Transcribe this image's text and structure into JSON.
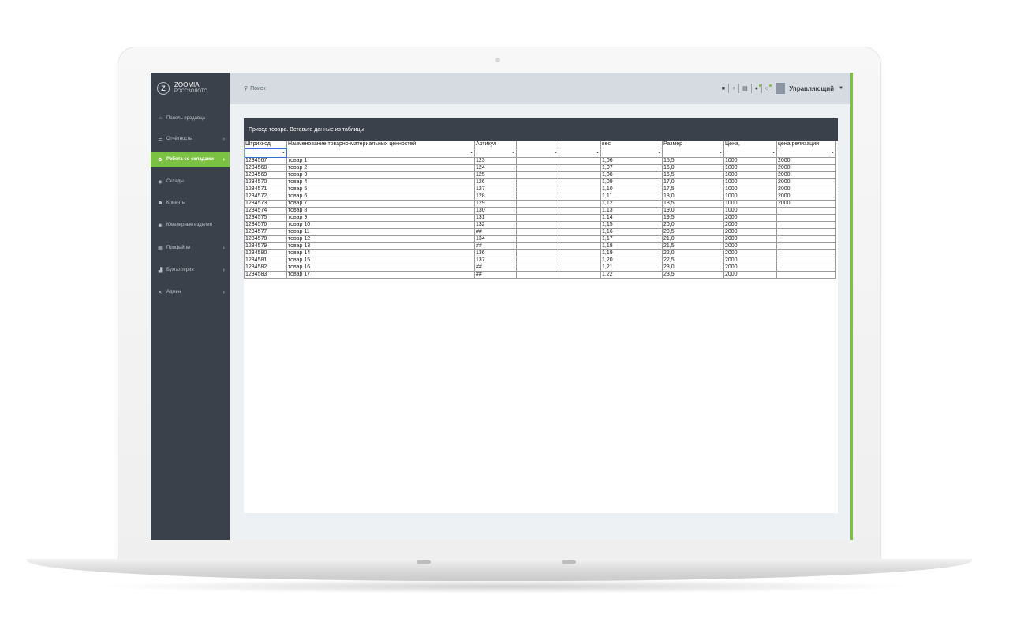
{
  "app": {
    "brand_name": "ZOOMIA",
    "brand_sub": "РОССЗОЛОТО",
    "logo_letter": "Z"
  },
  "colors": {
    "accent": "#7cc242",
    "sidebar": "#3a414a",
    "topbar": "#d5dbe1"
  },
  "sidebar": {
    "items": [
      {
        "label": "Панель продавца",
        "icon": "home-icon",
        "glyph": "⌂",
        "arrow": false,
        "active": false
      },
      {
        "label": "Отчётность",
        "icon": "list-icon",
        "glyph": "☰",
        "arrow": true,
        "active": false
      },
      {
        "label": "Работа со складами",
        "icon": "gear-icon",
        "glyph": "✿",
        "arrow": true,
        "active": true
      },
      {
        "label": "Склады",
        "icon": "cube-icon",
        "glyph": "◉",
        "arrow": false,
        "active": false
      },
      {
        "label": "Клиенты",
        "icon": "users-icon",
        "glyph": "☗",
        "arrow": false,
        "active": false
      },
      {
        "label": "Ювелирные изделия",
        "icon": "gem-icon",
        "glyph": "◉",
        "arrow": false,
        "active": false
      },
      {
        "label": "Профайлы",
        "icon": "grid-icon",
        "glyph": "▦",
        "arrow": true,
        "active": false
      },
      {
        "label": "Бухгалтерия",
        "icon": "chart-icon",
        "glyph": "▟",
        "arrow": true,
        "active": false
      },
      {
        "label": "Админ",
        "icon": "tools-icon",
        "glyph": "✕",
        "arrow": true,
        "active": false
      }
    ]
  },
  "topbar": {
    "search_placeholder": "Поиск",
    "user_name": "Управляющий"
  },
  "panel": {
    "title": "Приход товара. Вставьте данные из таблицы"
  },
  "table": {
    "columns": [
      "Штрихкод",
      "Наименование товарно-материальных ценностей",
      "Артикул",
      "",
      "",
      "вес",
      "Размер",
      "Цена,",
      "цена релизации"
    ],
    "rows": [
      [
        "1234567",
        "товар 1",
        "123",
        "",
        "",
        "1,06",
        "15,5",
        "1000",
        "2000"
      ],
      [
        "1234568",
        "товар 2",
        "124",
        "",
        "",
        "1,07",
        "16,0",
        "1000",
        "2000"
      ],
      [
        "1234569",
        "товар 3",
        "125",
        "",
        "",
        "1,08",
        "16,5",
        "1000",
        "2000"
      ],
      [
        "1234570",
        "товар 4",
        "126",
        "",
        "",
        "1,09",
        "17,0",
        "1000",
        "2000"
      ],
      [
        "1234571",
        "товар 5",
        "127",
        "",
        "",
        "1,10",
        "17,5",
        "1000",
        "2000"
      ],
      [
        "1234572",
        "товар 6",
        "128",
        "",
        "",
        "1,11",
        "18,0",
        "1000",
        "2000"
      ],
      [
        "1234573",
        "товар 7",
        "129",
        "",
        "",
        "1,12",
        "18,5",
        "1000",
        "2000"
      ],
      [
        "1234574",
        "товар 8",
        "130",
        "",
        "",
        "1,13",
        "19,0",
        "1000",
        ""
      ],
      [
        "1234575",
        "товар 9",
        "131",
        "",
        "",
        "1,14",
        "19,5",
        "2000",
        ""
      ],
      [
        "1234576",
        "товар 10",
        "132",
        "",
        "",
        "1,15",
        "20,0",
        "2000",
        ""
      ],
      [
        "1234577",
        "товар 11",
        "##",
        "",
        "",
        "1,16",
        "20,5",
        "2000",
        ""
      ],
      [
        "1234578",
        "товар 12",
        "134",
        "",
        "",
        "1,17",
        "21,0",
        "2000",
        ""
      ],
      [
        "1234579",
        "товар 13",
        "##",
        "",
        "",
        "1,18",
        "21,5",
        "2000",
        ""
      ],
      [
        "1234580",
        "товар 14",
        "136",
        "",
        "",
        "1,19",
        "22,0",
        "2000",
        ""
      ],
      [
        "1234581",
        "товар 15",
        "137",
        "",
        "",
        "1,20",
        "22,5",
        "2000",
        ""
      ],
      [
        "1234582",
        "товар 16",
        "##",
        "",
        "",
        "1,21",
        "23,0",
        "2000",
        ""
      ],
      [
        "1234583",
        "товар 17",
        "##",
        "",
        "",
        "1,22",
        "23,5",
        "2000",
        ""
      ]
    ]
  }
}
